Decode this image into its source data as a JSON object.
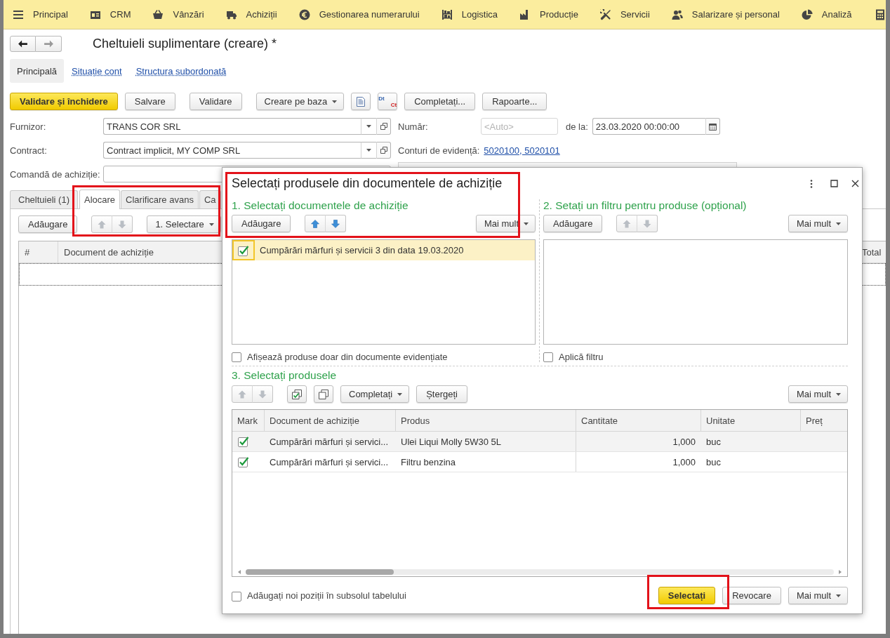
{
  "menu": [
    "Principal",
    "CRM",
    "Vânzări",
    "Achiziții",
    "Gestionarea numerarului",
    "Logistica",
    "Producție",
    "Servicii",
    "Salarizare și personal",
    "Analiză"
  ],
  "navigation": {
    "back": {
      "disabled": false
    },
    "forward": {
      "disabled": true
    }
  },
  "title": "Cheltuieli suplimentare (creare) *",
  "form_tabs": [
    {
      "label": "Principală",
      "selected": true
    },
    {
      "label": "Situație cont",
      "selected": false
    },
    {
      "label": "Structura subordonată",
      "selected": false
    }
  ],
  "toolbar": [
    [
      {
        "kind": "primary",
        "label": "Validare și închidere"
      },
      {
        "kind": "button",
        "label": "Salvare"
      }
    ],
    [
      {
        "kind": "button",
        "label": "Validare"
      }
    ],
    [
      {
        "kind": "dropdown",
        "label": "Creare pe baza"
      },
      {
        "kind": "icon"
      },
      {
        "kind": "ledger",
        "marks": [
          "Dt",
          "Ct"
        ]
      },
      {
        "kind": "button",
        "label": "Completați..."
      },
      {
        "kind": "button",
        "label": "Rapoarte..."
      }
    ]
  ],
  "fields": {
    "supplier": {
      "label": "Furnizor:",
      "value": "TRANS COR SRL"
    },
    "contract": {
      "label": "Contract:",
      "value": "Contract implicit, MY COMP SRL"
    },
    "purchase_order": {
      "label": "Comandă de achiziție:"
    },
    "number": {
      "label": "Număr:",
      "placeholder": "<Auto>"
    },
    "date": {
      "label": "de la:",
      "value": "23.03.2020 00:00:00"
    },
    "accounts": {
      "label": "Conturi de evidență:",
      "link": "5020100, 5020101"
    }
  },
  "detail_tabs": [
    {
      "label": "Cheltuieli (1)",
      "selected": false
    },
    {
      "label": "Alocare",
      "selected": true
    },
    {
      "label": "Clarificare avans",
      "selected": false
    },
    {
      "label": "Ca",
      "selected": false
    }
  ],
  "allocation": {
    "toolbar": [
      {
        "kind": "button",
        "label": "Adăugare"
      },
      {
        "kind": "arrows",
        "disabled": true
      },
      {
        "kind": "dropdown",
        "label": "1. Selectare"
      }
    ],
    "columns": [
      "#",
      "Document de achiziție",
      "Total"
    ]
  },
  "dialog": {
    "title": "Selectați produsele din documentele de achiziție",
    "documents": {
      "heading": "1. Selectați documentele de achiziție",
      "toolbar": [
        {
          "kind": "button",
          "label": "Adăugare"
        },
        {
          "kind": "arrows",
          "disabled": false
        },
        {
          "kind": "more",
          "label": "Mai mult"
        }
      ],
      "items": [
        {
          "label": "Cumpărări mărfuri și servicii 3 din data 19.03.2020",
          "checked": true,
          "selected": true
        }
      ],
      "option": {
        "label": "Afișează produse doar din documente evidențiate",
        "checked": false
      }
    },
    "filter": {
      "heading": "2. Setați un filtru pentru produse (opțional)",
      "toolbar": [
        {
          "kind": "button",
          "label": "Adăugare"
        },
        {
          "kind": "arrows",
          "disabled": true
        },
        {
          "kind": "more",
          "label": "Mai mult"
        }
      ],
      "option": {
        "label": "Aplică filtru",
        "checked": false
      }
    },
    "products": {
      "heading": "3. Selectați produsele",
      "toolbar": [
        {
          "kind": "arrows",
          "disabled": true
        },
        {
          "kind": "check-all"
        },
        {
          "kind": "uncheck-all"
        },
        {
          "kind": "dropdown",
          "label": "Completați"
        },
        {
          "kind": "button",
          "label": "Ștergeți"
        },
        {
          "kind": "more",
          "label": "Mai mult"
        }
      ],
      "mark_column": "Mark",
      "columns": [
        "Document de achiziție",
        "Produs",
        "Cantitate",
        "Unitate",
        "Preț"
      ],
      "rows": [
        {
          "mark": true,
          "selected": true,
          "cells": [
            "Cumpărări mărfuri și servici...",
            "Ulei Liqui Molly 5W30 5L",
            "1,000",
            "buc"
          ]
        },
        {
          "mark": true,
          "selected": false,
          "cells": [
            "Cumpărări mărfuri și servici...",
            "Filtru benzina",
            "1,000",
            "buc"
          ]
        }
      ]
    },
    "footer": {
      "option": {
        "label": "Adăugați noi poziții în subsolul tabelului",
        "checked": false
      },
      "buttons": [
        {
          "kind": "primary",
          "label": "Selectați"
        },
        {
          "kind": "button",
          "label": "Revocare"
        },
        {
          "kind": "more",
          "label": "Mai mult"
        }
      ]
    }
  },
  "annotations": [
    {
      "kind": "frame"
    },
    {
      "kind": "frame"
    },
    {
      "kind": "frame"
    }
  ]
}
